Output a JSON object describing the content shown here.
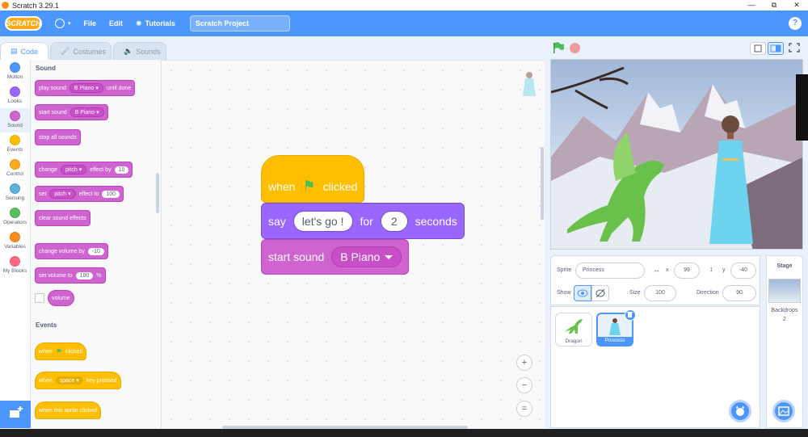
{
  "window": {
    "title": "Scratch 3.29.1",
    "controls": [
      "—",
      "⧉",
      "✕"
    ]
  },
  "menubar": {
    "logo": "SCRATCH",
    "file": "File",
    "edit": "Edit",
    "tutorials": "Tutorials",
    "project_title": "Scratch Project",
    "help": "?"
  },
  "tabs": {
    "code": "Code",
    "costumes": "Costumes",
    "sounds": "Sounds"
  },
  "categories": [
    {
      "label": "Motion",
      "color": "#4c97ff"
    },
    {
      "label": "Looks",
      "color": "#9966ff"
    },
    {
      "label": "Sound",
      "color": "#cf63cf"
    },
    {
      "label": "Events",
      "color": "#ffbf00"
    },
    {
      "label": "Control",
      "color": "#ffab19"
    },
    {
      "label": "Sensing",
      "color": "#5cb1d6"
    },
    {
      "label": "Operators",
      "color": "#59c059"
    },
    {
      "label": "Variables",
      "color": "#ff8c1a"
    },
    {
      "label": "My Blocks",
      "color": "#ff6680"
    }
  ],
  "palette": {
    "sound_title": "Sound",
    "play_sound": {
      "prefix": "play sound",
      "sound": "B Piano",
      "suffix": "until done"
    },
    "start_sound": {
      "prefix": "start sound",
      "sound": "B Piano"
    },
    "stop_all": "stop all sounds",
    "change_effect": {
      "prefix": "change",
      "effect": "pitch",
      "mid": "effect by",
      "value": "10"
    },
    "set_effect": {
      "prefix": "set",
      "effect": "pitch",
      "mid": "effect to",
      "value": "100"
    },
    "clear_effects": "clear sound effects",
    "change_volume": {
      "prefix": "change volume by",
      "value": "-10"
    },
    "set_volume": {
      "prefix": "set volume to",
      "value": "100",
      "suffix": "%"
    },
    "volume": "volume",
    "events_title": "Events",
    "when_flag": {
      "prefix": "when",
      "suffix": "clicked"
    },
    "when_key": {
      "prefix": "when",
      "key": "space",
      "suffix": "key pressed"
    },
    "when_sprite": "when this sprite clicked"
  },
  "script": {
    "hat": {
      "prefix": "when",
      "suffix": "clicked"
    },
    "say": {
      "prefix": "say",
      "message": "let's go !",
      "mid": "for",
      "secs": "2",
      "suffix": "seconds"
    },
    "start_sound": {
      "prefix": "start sound",
      "sound": "B Piano"
    }
  },
  "zoom": {
    "in": "+",
    "out": "−",
    "reset": "="
  },
  "sprite_info": {
    "sprite_label": "Sprite",
    "sprite_name": "Princess",
    "x_label": "x",
    "x": "99",
    "y_label": "y",
    "y": "-40",
    "show_label": "Show",
    "size_label": "Size",
    "size": "100",
    "direction_label": "Direction",
    "direction": "90"
  },
  "sprites": [
    {
      "name": "Dragon"
    },
    {
      "name": "Princess"
    }
  ],
  "stage_panel": {
    "title": "Stage",
    "backdrops_label": "Backdrops",
    "backdrops_count": "2"
  }
}
